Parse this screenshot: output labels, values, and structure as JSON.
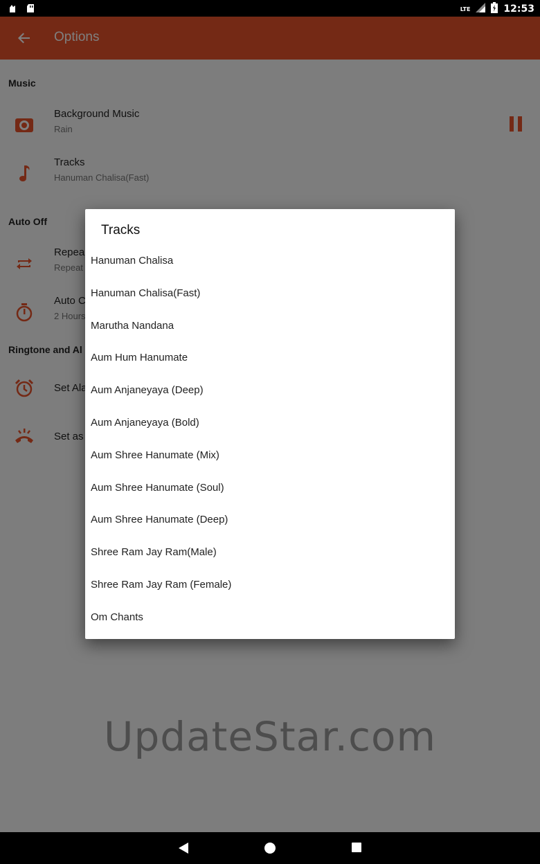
{
  "status_bar": {
    "network": "LTE",
    "time": "12:53"
  },
  "app_bar": {
    "title": "Options"
  },
  "sections": {
    "music": "Music",
    "auto_off": "Auto Off",
    "ringtone": "Ringtone and Al"
  },
  "rows": {
    "background_music": {
      "title": "Background Music",
      "subtitle": "Rain"
    },
    "tracks": {
      "title": "Tracks",
      "subtitle": "Hanuman Chalisa(Fast)"
    },
    "repeat": {
      "title": "Repea",
      "subtitle": "Repeat"
    },
    "auto_off": {
      "title": "Auto C",
      "subtitle": "2 Hours"
    },
    "set_alarm": {
      "title": "Set Ala"
    },
    "set_as": {
      "title": "Set as"
    }
  },
  "dialog": {
    "title": "Tracks",
    "items": [
      "Hanuman Chalisa",
      "Hanuman Chalisa(Fast)",
      "Marutha Nandana",
      "Aum Hum Hanumate",
      "Aum Anjaneyaya (Deep)",
      "Aum Anjaneyaya (Bold)",
      "Aum Shree Hanumate (Mix)",
      "Aum Shree Hanumate (Soul)",
      "Aum Shree Hanumate (Deep)",
      "Shree Ram Jay Ram(Male)",
      "Shree Ram Jay Ram (Female)",
      "Om Chants"
    ]
  },
  "watermark": "UpdateStar.com",
  "colors": {
    "accent": "#e8522a",
    "status_bar": "#000000"
  },
  "icons": [
    "back-arrow-icon",
    "speaker-icon",
    "music-note-icon",
    "repeat-icon",
    "timer-icon",
    "alarm-icon",
    "phone-ring-icon",
    "pause-icon"
  ]
}
